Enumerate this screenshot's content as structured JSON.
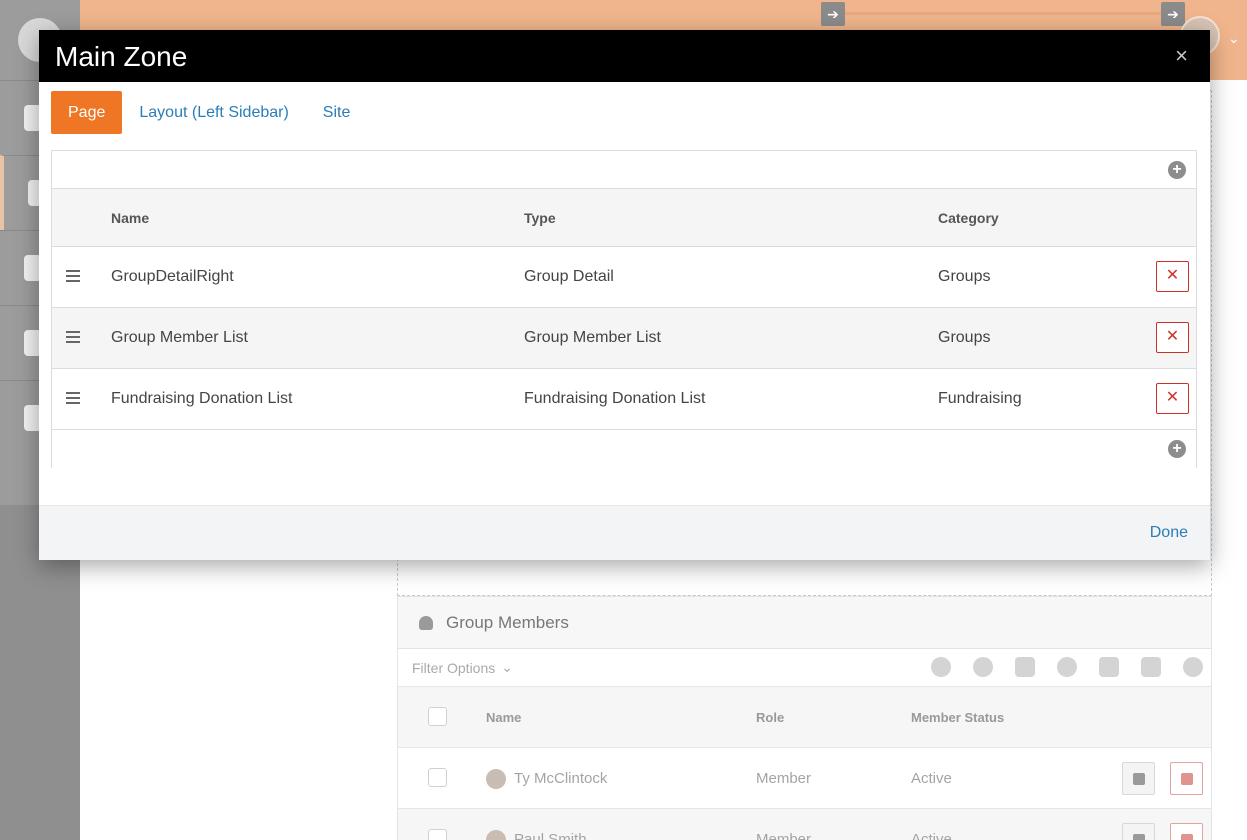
{
  "modal": {
    "title": "Main Zone",
    "close_symbol": "×",
    "tabs": [
      {
        "label": "Page",
        "active": true
      },
      {
        "label": "Layout (Left Sidebar)",
        "active": false
      },
      {
        "label": "Site",
        "active": false
      }
    ],
    "grid": {
      "columns": [
        "Name",
        "Type",
        "Category"
      ],
      "add_symbol": "+",
      "rows": [
        {
          "name": "GroupDetailRight",
          "type": "Group Detail",
          "category": "Groups"
        },
        {
          "name": "Group Member List",
          "type": "Group Member List",
          "category": "Groups"
        },
        {
          "name": "Fundraising Donation List",
          "type": "Fundraising Donation List",
          "category": "Fundraising"
        }
      ],
      "delete_symbol": "✕"
    },
    "footer": {
      "done_label": "Done"
    }
  },
  "background": {
    "header": {
      "arrow_symbol": "➔",
      "caret_symbol": "⌄"
    },
    "group_members": {
      "title": "Group Members",
      "filter_label": "Filter Options",
      "filter_caret": "⌄",
      "columns": [
        "Name",
        "Role",
        "Member Status"
      ],
      "rows": [
        {
          "name": "Ty McClintock",
          "role": "Member",
          "status": "Active"
        },
        {
          "name": "Paul Smith",
          "role": "Member",
          "status": "Active"
        }
      ]
    }
  },
  "colors": {
    "accent_orange": "#ee7624",
    "link_blue": "#2a7db8",
    "danger_red": "#c9302c",
    "header_black": "#000000"
  },
  "icons": [
    "users-icon",
    "drag-handle-icon",
    "add-circle-icon",
    "delete-icon",
    "close-icon",
    "arrow-right-icon",
    "chevron-down-icon"
  ]
}
